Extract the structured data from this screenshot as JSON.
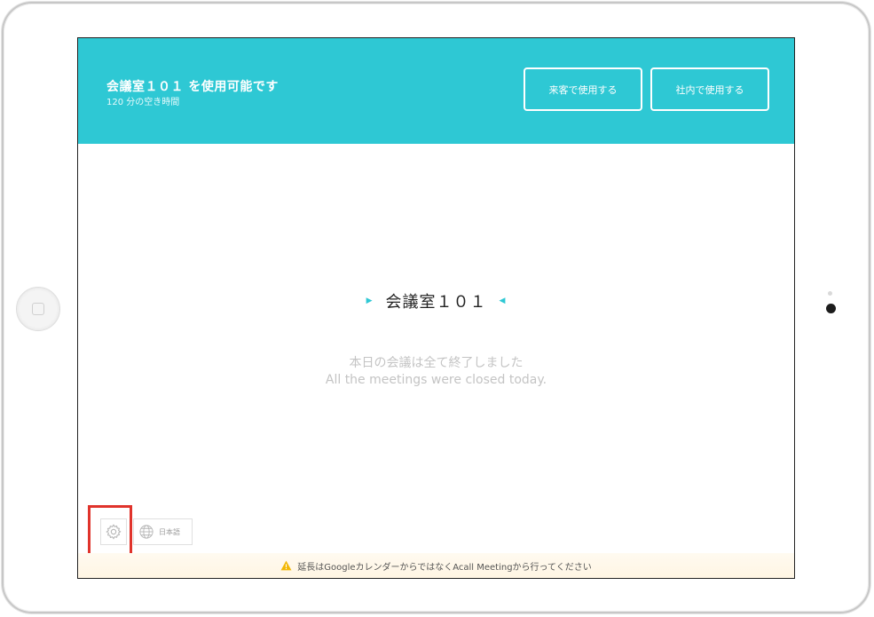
{
  "header": {
    "title": "会議室１０１ を使用可能です",
    "subtitle": "120 分の空き時間",
    "visitor_button": "来客で使用する",
    "internal_button": "社内で使用する"
  },
  "room": {
    "name": "会議室１０１"
  },
  "message": {
    "ja": "本日の会議は全て終了しました",
    "en": "All the meetings were closed today."
  },
  "footer": {
    "settings_icon": "gear-icon",
    "language_icon": "globe-icon",
    "language_label": "日本語",
    "notice_icon": "warning-icon",
    "notice": "延長はGoogleカレンダーからではなくAcall Meetingから行ってください"
  },
  "colors": {
    "accent": "#2ec8d4",
    "highlight": "#e0332b",
    "warning": "#f2b705"
  }
}
